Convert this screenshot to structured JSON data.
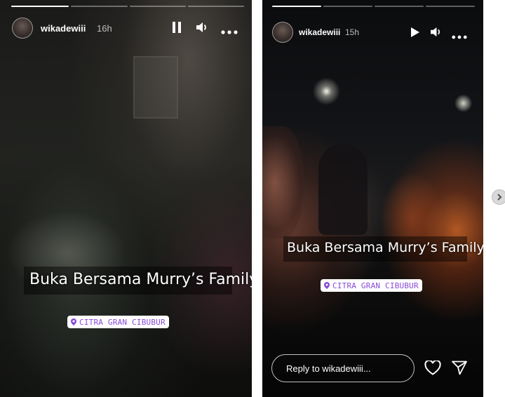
{
  "left_story": {
    "username": "wikadewiii",
    "time": "16h",
    "caption": "Buka Bersama Murry’s Family",
    "location": "CITRA GRAN CIBUBUR",
    "progress_done": 1,
    "progress_total": 4,
    "controls": [
      "pause-icon",
      "volume-icon",
      "more-icon"
    ]
  },
  "right_story": {
    "username": "wikadewiii",
    "time": "15h",
    "caption": "Buka Bersama Murry’s Family",
    "location": "CITRA GRAN CIBUBUR",
    "progress_done": 1,
    "progress_total": 4,
    "controls": [
      "play-icon",
      "volume-icon",
      "more-icon"
    ],
    "reply_placeholder": "Reply to wikadewiii...",
    "actions": [
      "heart-icon",
      "send-icon"
    ]
  },
  "colors": {
    "location_text": "#8a4bd8",
    "caption_text": "#ffffff",
    "page_bg": "#ffffff"
  }
}
